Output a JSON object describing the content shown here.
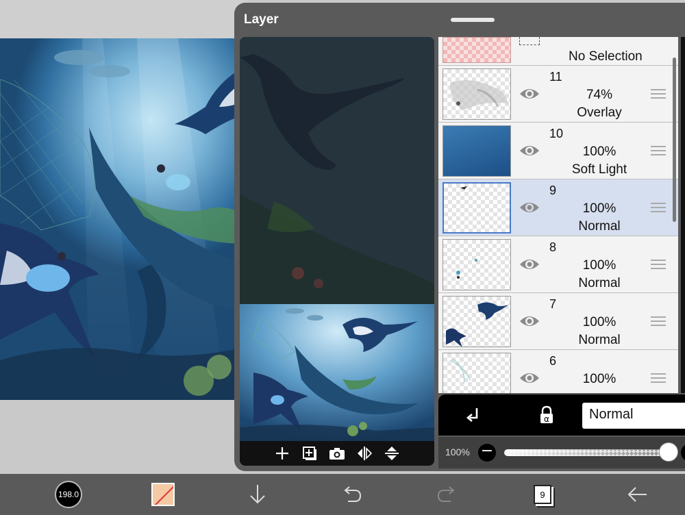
{
  "panel": {
    "title": "Layer"
  },
  "layers": {
    "no_selection_label": "No Selection",
    "rows": [
      {
        "number": "11",
        "opacity": "74%",
        "mode": "Overlay",
        "thumb": "overlay-texture"
      },
      {
        "number": "10",
        "opacity": "100%",
        "mode": "Soft Light",
        "thumb": "blue-gradient"
      },
      {
        "number": "9",
        "opacity": "100%",
        "mode": "Normal",
        "thumb": "sparse-fish",
        "selected": true
      },
      {
        "number": "8",
        "opacity": "100%",
        "mode": "Normal",
        "thumb": "tiny-figures"
      },
      {
        "number": "7",
        "opacity": "100%",
        "mode": "Normal",
        "thumb": "manta-rays"
      },
      {
        "number": "6",
        "opacity": "100%",
        "mode": "",
        "thumb": "net"
      }
    ]
  },
  "blend": {
    "mode_value": "Normal",
    "clip_icon": "clip-arrow-icon",
    "alpha_icon": "alpha-lock-icon"
  },
  "opacity": {
    "label": "100%",
    "level": 1.0
  },
  "preview_toolbar": {
    "add_icon": "plus-icon",
    "duplicate_icon": "add-layer-icon",
    "camera_icon": "camera-icon",
    "flip_h_icon": "flip-horizontal-icon",
    "flip_v_icon": "flip-vertical-icon"
  },
  "bottom_toolbar": {
    "brush_size": "198.0",
    "layer_count": "9",
    "icons": [
      "brush-size-icon",
      "color-swatch",
      "arrow-down-icon",
      "undo-icon",
      "redo-icon",
      "layers-icon",
      "back-arrow-icon"
    ]
  },
  "colors": {
    "panel_bg": "#5a5a5a",
    "selected_row": "#d6dfef",
    "accent_border": "#4a78c8",
    "swatch": "#f4c9a4"
  }
}
